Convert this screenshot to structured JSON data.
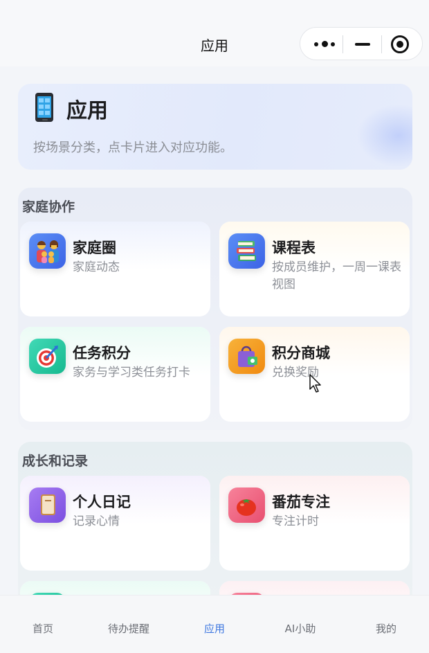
{
  "nav": {
    "title": "应用"
  },
  "hero": {
    "title": "应用",
    "subtitle": "按场景分类，点卡片进入对应功能。",
    "icon": "mobile-phone-icon"
  },
  "sections": [
    {
      "title": "家庭协作",
      "cards": [
        {
          "title": "家庭圈",
          "desc": "家庭动态",
          "icon": "family-icon"
        },
        {
          "title": "课程表",
          "desc": "按成员维护，一周一课表视图",
          "icon": "books-icon"
        },
        {
          "title": "任务积分",
          "desc": "家务与学习类任务打卡",
          "icon": "target-icon"
        },
        {
          "title": "积分商城",
          "desc": "兑换奖励",
          "icon": "shopping-bag-icon"
        }
      ]
    },
    {
      "title": "成长和记录",
      "cards": [
        {
          "title": "个人日记",
          "desc": "记录心情",
          "icon": "diary-icon"
        },
        {
          "title": "番茄专注",
          "desc": "专注计时",
          "icon": "tomato-icon"
        }
      ]
    }
  ],
  "tabs": [
    {
      "label": "首页"
    },
    {
      "label": "待办提醒"
    },
    {
      "label": "应用",
      "active": true
    },
    {
      "label": "AI小助"
    },
    {
      "label": "我的"
    }
  ],
  "colors": {
    "accent": "#3f78e0"
  }
}
